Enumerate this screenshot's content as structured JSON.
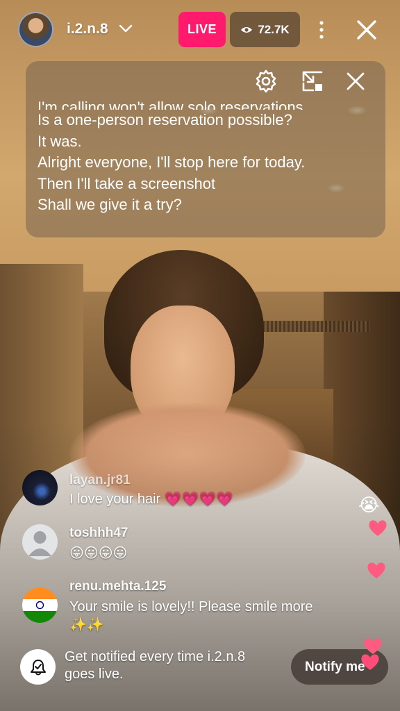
{
  "host": {
    "username": "i.2.n.8"
  },
  "live_badge": "LIVE",
  "viewers": "72.7K",
  "captions": {
    "partial_line": "I'm calling won't allow solo reservations.",
    "lines": [
      "Is a one-person reservation possible?",
      "It was.",
      "Alright everyone, I'll stop here for today.",
      "Then I'll take a screenshot",
      "Shall we give it a try?"
    ]
  },
  "comments": [
    {
      "username": "layan.jr81",
      "text": "I love your hair 💗💗💗💗"
    },
    {
      "username": "toshhh47",
      "text": "😛😛😛😛"
    },
    {
      "username": "renu.mehta.125",
      "text": "Your smile is lovely!! Please smile more ✨✨"
    }
  ],
  "notify": {
    "text": "Get notified every time i.2.n.8 goes live.",
    "button_label": "Notify me"
  },
  "floating_reactions": [
    "😭",
    "💗",
    "💗",
    "💗",
    "💗"
  ],
  "colors": {
    "live": "#ff1a6d",
    "heart": "#ff4d79"
  },
  "icons": [
    "avatar",
    "chevron-down-icon",
    "eye-icon",
    "more-vertical-icon",
    "close-icon",
    "settings-gear-icon",
    "collapse-icon",
    "bell-icon"
  ]
}
